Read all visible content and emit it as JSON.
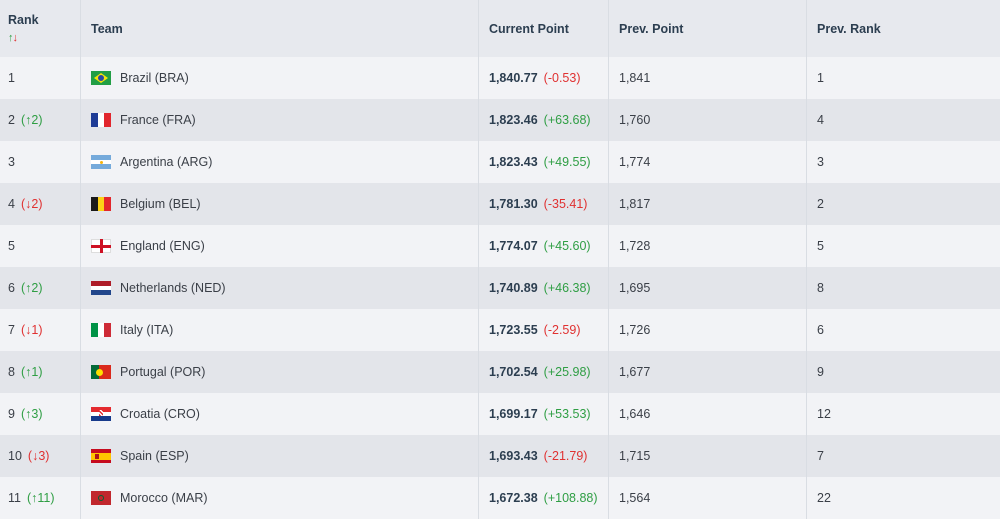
{
  "header": {
    "rank": "Rank",
    "sort_up": "↑",
    "sort_down": "↓",
    "team": "Team",
    "current": "Current Point",
    "prev_point": "Prev. Point",
    "prev_rank": "Prev. Rank"
  },
  "rows": [
    {
      "rank": "1",
      "move": "",
      "move_dir": "",
      "team": "Brazil (BRA)",
      "flag": "brazil-flag",
      "points": "1,840.77",
      "delta": "(-0.53)",
      "delta_dir": "down",
      "prev_point": "1,841",
      "prev_rank": "1"
    },
    {
      "rank": "2",
      "move": "(↑2)",
      "move_dir": "up",
      "team": "France (FRA)",
      "flag": "france-flag",
      "points": "1,823.46",
      "delta": "(+63.68)",
      "delta_dir": "up",
      "prev_point": "1,760",
      "prev_rank": "4"
    },
    {
      "rank": "3",
      "move": "",
      "move_dir": "",
      "team": "Argentina (ARG)",
      "flag": "argentina-flag",
      "points": "1,823.43",
      "delta": "(+49.55)",
      "delta_dir": "up",
      "prev_point": "1,774",
      "prev_rank": "3"
    },
    {
      "rank": "4",
      "move": "(↓2)",
      "move_dir": "down",
      "team": "Belgium (BEL)",
      "flag": "belgium-flag",
      "points": "1,781.30",
      "delta": "(-35.41)",
      "delta_dir": "down",
      "prev_point": "1,817",
      "prev_rank": "2"
    },
    {
      "rank": "5",
      "move": "",
      "move_dir": "",
      "team": "England (ENG)",
      "flag": "england-flag",
      "points": "1,774.07",
      "delta": "(+45.60)",
      "delta_dir": "up",
      "prev_point": "1,728",
      "prev_rank": "5"
    },
    {
      "rank": "6",
      "move": "(↑2)",
      "move_dir": "up",
      "team": "Netherlands (NED)",
      "flag": "netherlands-flag",
      "points": "1,740.89",
      "delta": "(+46.38)",
      "delta_dir": "up",
      "prev_point": "1,695",
      "prev_rank": "8"
    },
    {
      "rank": "7",
      "move": "(↓1)",
      "move_dir": "down",
      "team": "Italy (ITA)",
      "flag": "italy-flag",
      "points": "1,723.55",
      "delta": "(-2.59)",
      "delta_dir": "down",
      "prev_point": "1,726",
      "prev_rank": "6"
    },
    {
      "rank": "8",
      "move": "(↑1)",
      "move_dir": "up",
      "team": "Portugal (POR)",
      "flag": "portugal-flag",
      "points": "1,702.54",
      "delta": "(+25.98)",
      "delta_dir": "up",
      "prev_point": "1,677",
      "prev_rank": "9"
    },
    {
      "rank": "9",
      "move": "(↑3)",
      "move_dir": "up",
      "team": "Croatia (CRO)",
      "flag": "croatia-flag",
      "points": "1,699.17",
      "delta": "(+53.53)",
      "delta_dir": "up",
      "prev_point": "1,646",
      "prev_rank": "12"
    },
    {
      "rank": "10",
      "move": "(↓3)",
      "move_dir": "down",
      "team": "Spain (ESP)",
      "flag": "spain-flag",
      "points": "1,693.43",
      "delta": "(-21.79)",
      "delta_dir": "down",
      "prev_point": "1,715",
      "prev_rank": "7"
    },
    {
      "rank": "11",
      "move": "(↑11)",
      "move_dir": "up",
      "team": "Morocco (MAR)",
      "flag": "morocco-flag",
      "points": "1,672.38",
      "delta": "(+108.88)",
      "delta_dir": "up",
      "prev_point": "1,564",
      "prev_rank": "22"
    }
  ]
}
